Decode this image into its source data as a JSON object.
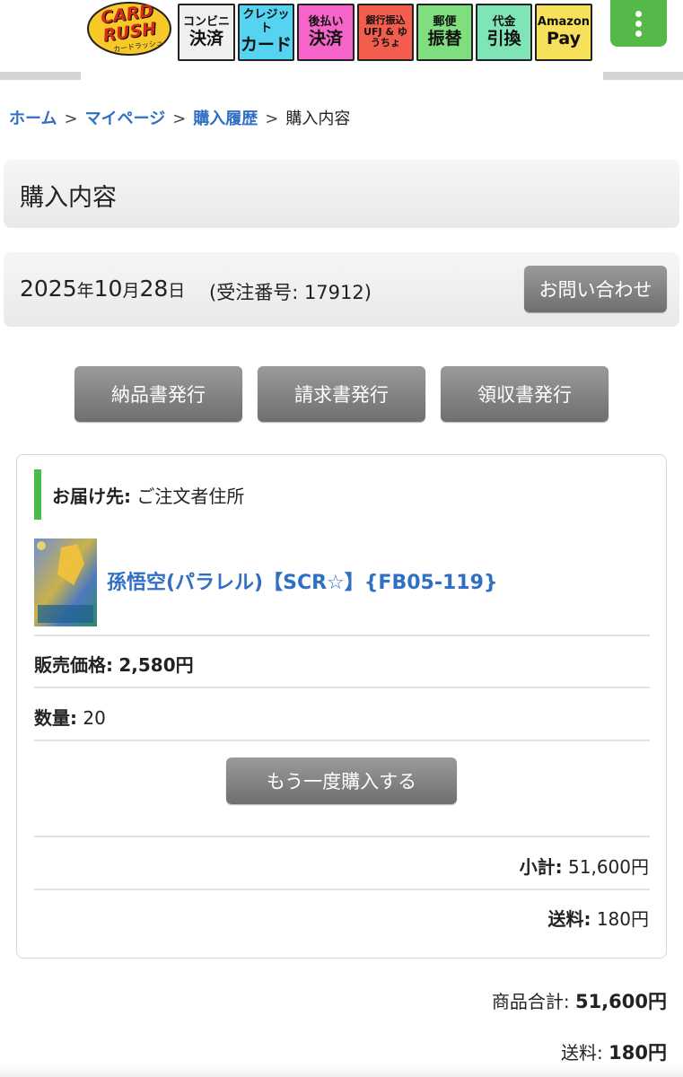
{
  "header": {
    "logo": {
      "line1": "CARD",
      "line2": "RUSH",
      "sub": "カードラッシュ"
    },
    "payment_badges": [
      {
        "line1": "コンビニ",
        "line2": "決済",
        "color": "#f0f0f0",
        "small": false
      },
      {
        "line1": "クレジット",
        "line2": "カード",
        "color": "#55d3f0",
        "small": false
      },
      {
        "line1": "後払い",
        "line2": "決済",
        "color": "#f565c9",
        "small": false
      },
      {
        "line1": "銀行振込",
        "line2": "UFJ & ゆうちょ",
        "color": "#f35d4e",
        "small": true
      },
      {
        "line1": "郵便",
        "line2": "振替",
        "color": "#7fdf7f",
        "small": false
      },
      {
        "line1": "代金",
        "line2": "引換",
        "color": "#7fe4b6",
        "small": false
      },
      {
        "line1": "Amazon",
        "line2": "Pay",
        "color": "#f8e15a",
        "small": false
      }
    ],
    "menu_icon": "kebab-menu-icon"
  },
  "breadcrumb": {
    "items": [
      "ホーム",
      "マイページ",
      "購入履歴"
    ],
    "separator": ">",
    "current": "購入内容"
  },
  "page_title": "購入内容",
  "order": {
    "year": "2025",
    "year_unit": "年",
    "month": "10",
    "month_unit": "月",
    "day": "28",
    "day_unit": "日",
    "order_number": "(受注番号: 17912)",
    "contact_label": "お問い合わせ"
  },
  "document_buttons": [
    "納品書発行",
    "請求書発行",
    "領収書発行"
  ],
  "delivery": {
    "label": "お届け先:",
    "value": "ご注文者住所"
  },
  "product": {
    "name": "孫悟空(パラレル)【SCR☆】{FB05-119}",
    "price_label": "販売価格:",
    "price_value": "2,580円",
    "qty_label": "数量:",
    "qty_value": "20",
    "rebuy_label": "もう一度購入する"
  },
  "subtotal": {
    "label": "小計:",
    "value": "51,600円"
  },
  "shipping": {
    "label": "送料:",
    "value": "180円"
  },
  "totals": {
    "goods_label": "商品合計:",
    "goods_value": "51,600円",
    "shipping_label": "送料:",
    "shipping_value": "180円"
  },
  "colors": {
    "link": "#2f6fc4",
    "accent_green": "#4cba48",
    "button_gray": "#7f7f7f"
  }
}
